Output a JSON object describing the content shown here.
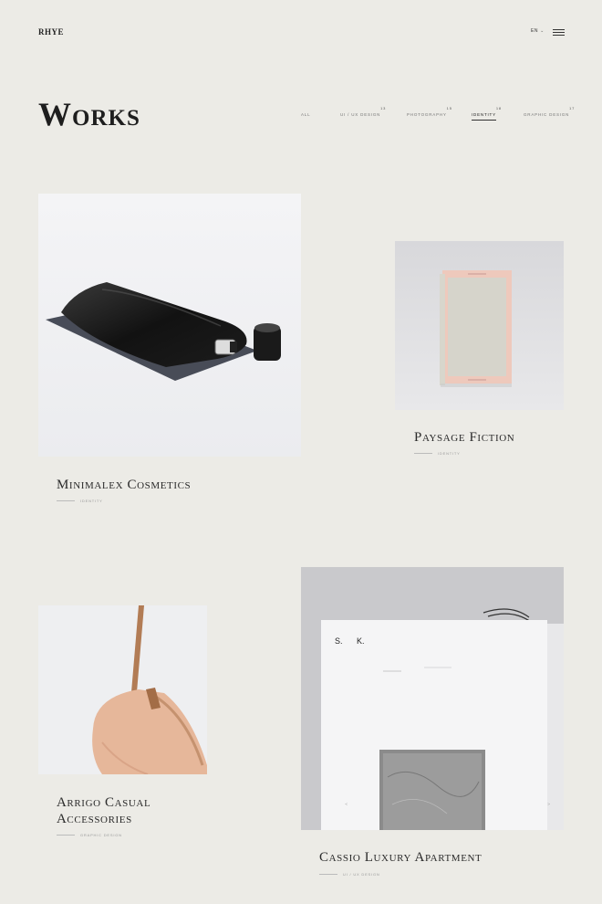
{
  "header": {
    "logo": "RHYE",
    "lang": "EN",
    "menu_icon": "hamburger-menu-icon"
  },
  "page": {
    "title": "Works"
  },
  "filters": [
    {
      "label": "All",
      "count": "",
      "active": false
    },
    {
      "label": "UI / UX Design",
      "count": "13",
      "active": false
    },
    {
      "label": "Photography",
      "count": "15",
      "active": false
    },
    {
      "label": "Identity",
      "count": "18",
      "active": true
    },
    {
      "label": "Graphic Design",
      "count": "17",
      "active": false
    }
  ],
  "works": [
    {
      "title": "Minimalex Cosmetics",
      "category": "Identity"
    },
    {
      "title": "Paysage Fiction",
      "category": "Identity"
    },
    {
      "title_line1": "Arrigo Casual",
      "title_line2": "Accessories",
      "category": "Graphic Design"
    },
    {
      "title": "Cassio Luxury Apartment",
      "category": "UI / UX Design",
      "book_text_1": "S.",
      "book_text_2": "K."
    }
  ],
  "colors": {
    "background": "#ecebe6",
    "text": "#2a2a2a",
    "muted": "#999999"
  }
}
